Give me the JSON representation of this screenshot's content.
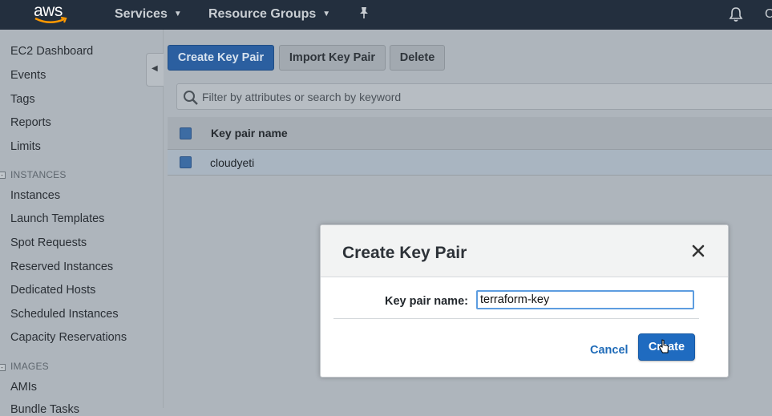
{
  "topbar": {
    "logo": "aws",
    "services": "Services",
    "resource_groups": "Resource Groups",
    "cut_off_text": "C",
    "icons": [
      "pin-icon",
      "bell-icon"
    ]
  },
  "sidebar": {
    "items": [
      "EC2 Dashboard",
      "Events",
      "Tags",
      "Reports",
      "Limits"
    ],
    "sections": [
      {
        "header": "INSTANCES",
        "items": [
          "Instances",
          "Launch Templates",
          "Spot Requests",
          "Reserved Instances",
          "Dedicated Hosts",
          "Scheduled Instances",
          "Capacity Reservations"
        ]
      },
      {
        "header": "IMAGES",
        "items": [
          "AMIs",
          "Bundle Tasks"
        ]
      }
    ]
  },
  "toolbar": {
    "create": "Create Key Pair",
    "import": "Import Key Pair",
    "delete": "Delete"
  },
  "filter": {
    "placeholder": "Filter by attributes or search by keyword"
  },
  "table": {
    "header": "Key pair name",
    "rows": [
      {
        "name": "cloudyeti",
        "selected": true
      }
    ]
  },
  "modal": {
    "title": "Create Key Pair",
    "field_label": "Key pair name:",
    "field_value": "terraform-key",
    "cancel": "Cancel",
    "create": "Create"
  },
  "colors": {
    "topbar": "#232f3e",
    "primary_button": "#1f6bc0",
    "link": "#1f6bb8",
    "input_focus": "#5d9de0"
  }
}
